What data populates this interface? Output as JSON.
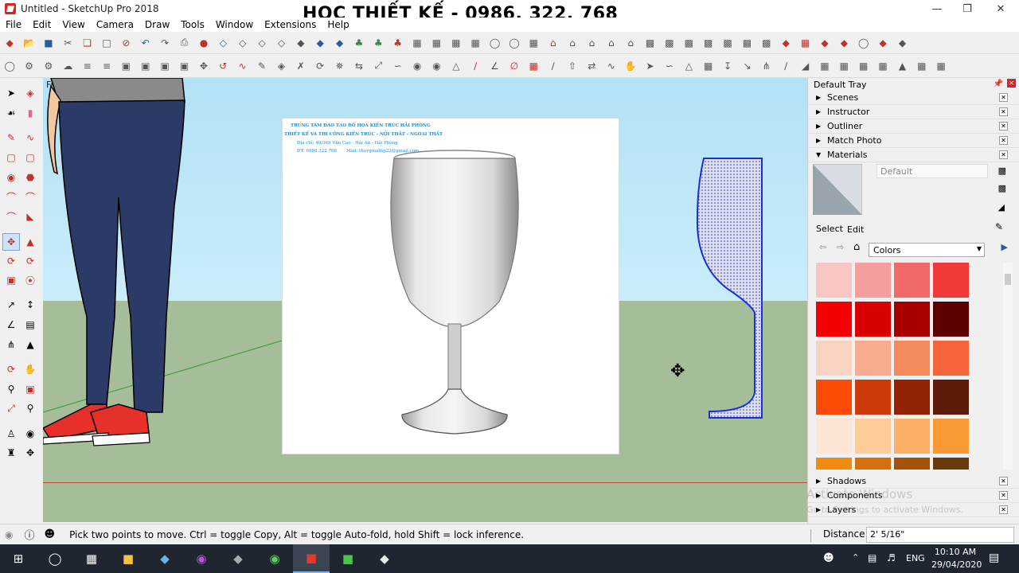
{
  "window": {
    "title": "Untitled - SketchUp Pro 2018",
    "banner": "HỌC THIẾT KẾ - 0986. 322. 768"
  },
  "menu": [
    "File",
    "Edit",
    "View",
    "Camera",
    "Draw",
    "Tools",
    "Window",
    "Extensions",
    "Help"
  ],
  "viewport": {
    "view_label": "Front"
  },
  "photo": {
    "line1": "TRUNG TÂM ĐÀO TẠO ĐỒ HỌA KIẾN TRÚC HẢI PHÒNG",
    "line2": "THIẾT KẾ VÀ THI CÔNG KIẾN TRÚC - NỘI THẤT - NGOẠI THẤT",
    "line3": "Địa chỉ: 40/369 Văn Cao - Hải An - Hải Phòng",
    "line4": "ĐT: 0986 322 768",
    "line5": "Mail: thuygmathp22@gmail.com"
  },
  "tray": {
    "title": "Default Tray",
    "panels": [
      "Scenes",
      "Instructor",
      "Outliner",
      "Match Photo"
    ],
    "materials_label": "Materials",
    "material_name": "Default",
    "tab_select": "Select",
    "tab_edit": "Edit",
    "collection": "Colors",
    "bottom_panels": [
      "Shadows",
      "Components",
      "Layers"
    ],
    "watermark1": "Activate Windows",
    "watermark2": "Go to Settings to activate Windows."
  },
  "swatches": [
    "#f9c6c6",
    "#f59f9f",
    "#f06a6a",
    "#f03a3a",
    "#f50000",
    "#d90000",
    "#a80000",
    "#5c0000",
    "#fbd3c3",
    "#f8ab8e",
    "#f58a5c",
    "#f4663a",
    "#fb4b06",
    "#cc3a0a",
    "#922306",
    "#5c1a09",
    "#fbe6d6",
    "#fdcc99",
    "#fbb066",
    "#fa9a35",
    "#f18a10",
    "#d4700d",
    "#a3540a",
    "#6b3908"
  ],
  "status": {
    "message": "Pick two points to move.  Ctrl = toggle Copy, Alt = toggle Auto-fold, hold Shift = lock inference.",
    "distance_label": "Distance",
    "distance_value": "2' 5/16\""
  },
  "taskbar": {
    "lang": "ENG",
    "time": "10:10 AM",
    "date": "29/04/2020"
  }
}
